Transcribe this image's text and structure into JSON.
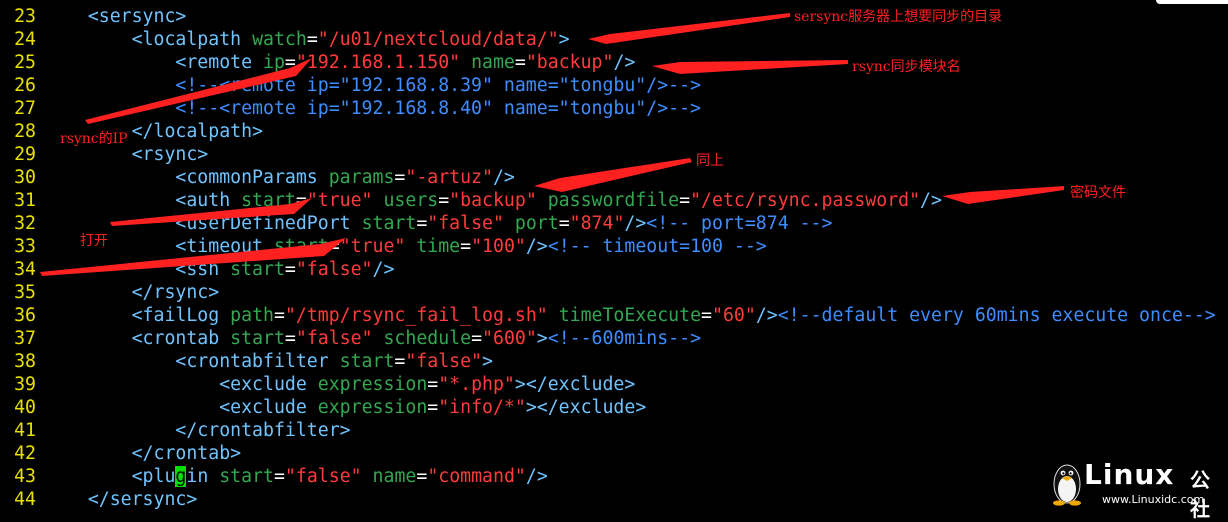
{
  "editor": {
    "lines": [
      {
        "num": "23",
        "indent": "    ",
        "tokens": [
          [
            "t",
            "<sersync>"
          ]
        ]
      },
      {
        "num": "24",
        "indent": "        ",
        "tokens": [
          [
            "t",
            "<localpath "
          ],
          [
            "a",
            "watch"
          ],
          [
            "p",
            "="
          ],
          [
            "v",
            "\"/u01/nextcloud/data/\""
          ],
          [
            "t",
            ">"
          ]
        ]
      },
      {
        "num": "25",
        "indent": "            ",
        "tokens": [
          [
            "t",
            "<remote "
          ],
          [
            "a",
            "ip"
          ],
          [
            "p",
            "="
          ],
          [
            "v",
            "\"192.168.1.150\""
          ],
          [
            "p",
            " "
          ],
          [
            "a",
            "name"
          ],
          [
            "p",
            "="
          ],
          [
            "v",
            "\"backup\""
          ],
          [
            "t",
            "/>"
          ]
        ]
      },
      {
        "num": "26",
        "indent": "            ",
        "tokens": [
          [
            "c",
            "<!--<remote ip=\"192.168.8.39\" name=\"tongbu\"/>-->"
          ]
        ]
      },
      {
        "num": "27",
        "indent": "            ",
        "tokens": [
          [
            "c",
            "<!--<remote ip=\"192.168.8.40\" name=\"tongbu\"/>-->"
          ]
        ]
      },
      {
        "num": "28",
        "indent": "        ",
        "tokens": [
          [
            "t",
            "</localpath>"
          ]
        ]
      },
      {
        "num": "29",
        "indent": "        ",
        "tokens": [
          [
            "t",
            "<rsync>"
          ]
        ]
      },
      {
        "num": "30",
        "indent": "            ",
        "tokens": [
          [
            "t",
            "<commonParams "
          ],
          [
            "a",
            "params"
          ],
          [
            "p",
            "="
          ],
          [
            "v",
            "\"-artuz\""
          ],
          [
            "t",
            "/>"
          ]
        ]
      },
      {
        "num": "31",
        "indent": "            ",
        "tokens": [
          [
            "t",
            "<auth "
          ],
          [
            "a",
            "start"
          ],
          [
            "p",
            "="
          ],
          [
            "v",
            "\"true\""
          ],
          [
            "p",
            " "
          ],
          [
            "a",
            "users"
          ],
          [
            "p",
            "="
          ],
          [
            "v",
            "\"backup\""
          ],
          [
            "p",
            " "
          ],
          [
            "a",
            "passwordfile"
          ],
          [
            "p",
            "="
          ],
          [
            "v",
            "\"/etc/rsync.password\""
          ],
          [
            "t",
            "/>"
          ]
        ]
      },
      {
        "num": "32",
        "indent": "            ",
        "tokens": [
          [
            "t",
            "<userDefinedPort "
          ],
          [
            "a",
            "start"
          ],
          [
            "p",
            "="
          ],
          [
            "v",
            "\"false\""
          ],
          [
            "p",
            " "
          ],
          [
            "a",
            "port"
          ],
          [
            "p",
            "="
          ],
          [
            "v",
            "\"874\""
          ],
          [
            "t",
            "/>"
          ],
          [
            "c",
            "<!-- port=874 -->"
          ]
        ]
      },
      {
        "num": "33",
        "indent": "            ",
        "tokens": [
          [
            "t",
            "<timeout "
          ],
          [
            "a",
            "start"
          ],
          [
            "p",
            "="
          ],
          [
            "v",
            "\"true\""
          ],
          [
            "p",
            " "
          ],
          [
            "a",
            "time"
          ],
          [
            "p",
            "="
          ],
          [
            "v",
            "\"100\""
          ],
          [
            "t",
            "/>"
          ],
          [
            "c",
            "<!-- timeout=100 -->"
          ]
        ]
      },
      {
        "num": "34",
        "indent": "            ",
        "tokens": [
          [
            "t",
            "<ssh "
          ],
          [
            "a",
            "start"
          ],
          [
            "p",
            "="
          ],
          [
            "v",
            "\"false\""
          ],
          [
            "t",
            "/>"
          ]
        ]
      },
      {
        "num": "35",
        "indent": "        ",
        "tokens": [
          [
            "t",
            "</rsync>"
          ]
        ]
      },
      {
        "num": "36",
        "indent": "        ",
        "tokens": [
          [
            "t",
            "<failLog "
          ],
          [
            "a",
            "path"
          ],
          [
            "p",
            "="
          ],
          [
            "v",
            "\"/tmp/rsync_fail_log.sh\""
          ],
          [
            "p",
            " "
          ],
          [
            "a",
            "timeToExecute"
          ],
          [
            "p",
            "="
          ],
          [
            "v",
            "\"60\""
          ],
          [
            "t",
            "/>"
          ],
          [
            "c",
            "<!--default every 60mins execute once-->"
          ]
        ]
      },
      {
        "num": "37",
        "indent": "        ",
        "tokens": [
          [
            "t",
            "<crontab "
          ],
          [
            "a",
            "start"
          ],
          [
            "p",
            "="
          ],
          [
            "v",
            "\"false\""
          ],
          [
            "p",
            " "
          ],
          [
            "a",
            "schedule"
          ],
          [
            "p",
            "="
          ],
          [
            "v",
            "\"600\""
          ],
          [
            "t",
            ">"
          ],
          [
            "c",
            "<!--600mins-->"
          ]
        ]
      },
      {
        "num": "38",
        "indent": "            ",
        "tokens": [
          [
            "t",
            "<crontabfilter "
          ],
          [
            "a",
            "start"
          ],
          [
            "p",
            "="
          ],
          [
            "v",
            "\"false\""
          ],
          [
            "t",
            ">"
          ]
        ]
      },
      {
        "num": "39",
        "indent": "                ",
        "tokens": [
          [
            "t",
            "<exclude "
          ],
          [
            "a",
            "expression"
          ],
          [
            "p",
            "="
          ],
          [
            "v",
            "\"*.php\""
          ],
          [
            "t",
            "></exclude>"
          ]
        ]
      },
      {
        "num": "40",
        "indent": "                ",
        "tokens": [
          [
            "t",
            "<exclude "
          ],
          [
            "a",
            "expression"
          ],
          [
            "p",
            "="
          ],
          [
            "v",
            "\"info/*\""
          ],
          [
            "t",
            "></exclude>"
          ]
        ]
      },
      {
        "num": "41",
        "indent": "            ",
        "tokens": [
          [
            "t",
            "</crontabfilter>"
          ]
        ]
      },
      {
        "num": "42",
        "indent": "        ",
        "tokens": [
          [
            "t",
            "</crontab>"
          ]
        ]
      },
      {
        "num": "43",
        "indent": "        ",
        "tokens": [
          [
            "t",
            "<plu"
          ],
          [
            "cursor",
            "g"
          ],
          [
            "t",
            "in "
          ],
          [
            "a",
            "start"
          ],
          [
            "p",
            "="
          ],
          [
            "v",
            "\"false\""
          ],
          [
            "p",
            " "
          ],
          [
            "a",
            "name"
          ],
          [
            "p",
            "="
          ],
          [
            "v",
            "\"command\""
          ],
          [
            "t",
            "/>"
          ]
        ]
      },
      {
        "num": "44",
        "indent": "    ",
        "tokens": [
          [
            "t",
            "</sersync>"
          ]
        ]
      }
    ]
  },
  "annotations": {
    "sersync_dir": "sersync服务器上想要同步的目录",
    "rsync_module": "rsync同步模块名",
    "rsync_ip": "rsync的IP",
    "same": "同上",
    "password_file": "密码文件",
    "open": "打开"
  },
  "logo": {
    "main": "Linux",
    "cn": "公社",
    "sub": "www.Linuxidc.com"
  },
  "colors": {
    "background": "#000000",
    "line_number": "#e8e000",
    "tag": "#6fc4ff",
    "attribute": "#32a852",
    "value": "#ff3b3b",
    "comment": "#3d8dff",
    "cursor": "#00e000",
    "annotation": "#ff2020"
  }
}
